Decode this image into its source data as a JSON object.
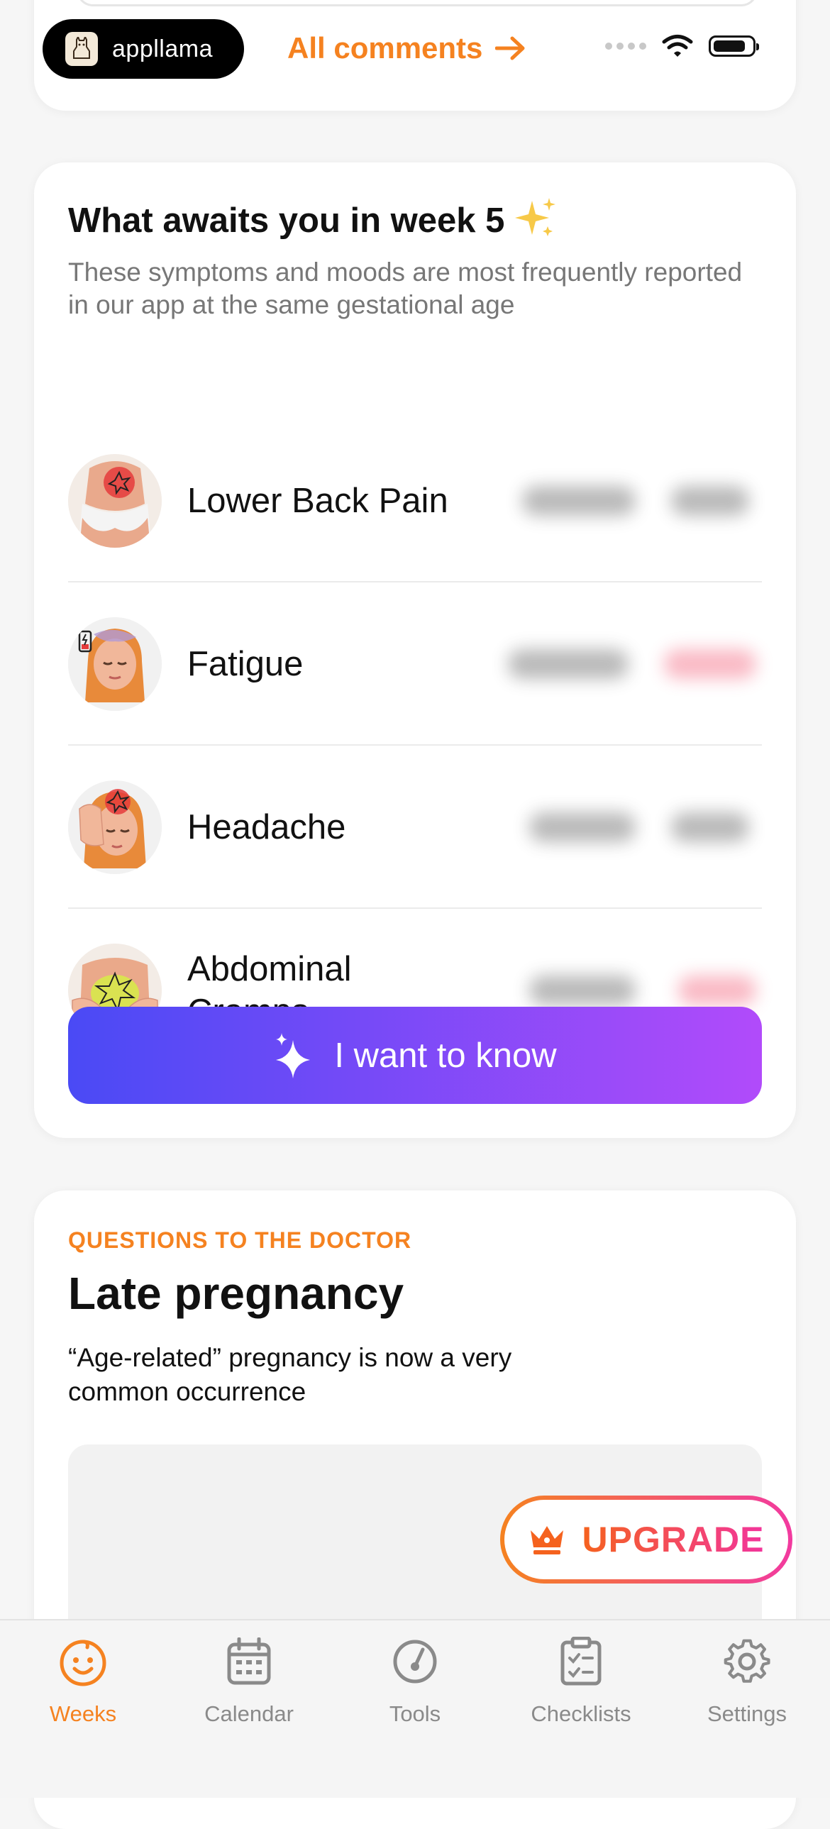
{
  "header": {
    "brand_name": "appllama",
    "all_comments_label": "All comments"
  },
  "symptoms_section": {
    "title": "What awaits you in week 5",
    "subtitle": "These symptoms and moods are most frequently reported in our app at the same gestational age",
    "items": [
      {
        "label": "Lower Back Pain",
        "avatar_icon": "lower-back-pain-icon"
      },
      {
        "label": "Fatigue",
        "avatar_icon": "fatigue-icon"
      },
      {
        "label": "Headache",
        "avatar_icon": "headache-icon"
      },
      {
        "label": "Abdominal Cramps",
        "avatar_icon": "abdominal-cramps-icon"
      }
    ],
    "cta_label": "I want to know"
  },
  "doctor_section": {
    "eyebrow": "QUESTIONS TO THE DOCTOR",
    "title": "Late pregnancy",
    "description": "“Age-related” pregnancy is now a very common occurrence"
  },
  "upgrade": {
    "label": "UPGRADE"
  },
  "tabs": [
    {
      "label": "Weeks",
      "icon": "baby-face-icon",
      "active": true
    },
    {
      "label": "Calendar",
      "icon": "calendar-icon",
      "active": false
    },
    {
      "label": "Tools",
      "icon": "tools-icon",
      "active": false
    },
    {
      "label": "Checklists",
      "icon": "checklist-icon",
      "active": false
    },
    {
      "label": "Settings",
      "icon": "gear-icon",
      "active": false
    }
  ],
  "colors": {
    "accent_orange": "#f58220",
    "cta_gradient_start": "#4a4af5",
    "cta_gradient_end": "#b14bfa",
    "upgrade_gradient_start": "#f58220",
    "upgrade_gradient_end": "#f23aa0"
  }
}
